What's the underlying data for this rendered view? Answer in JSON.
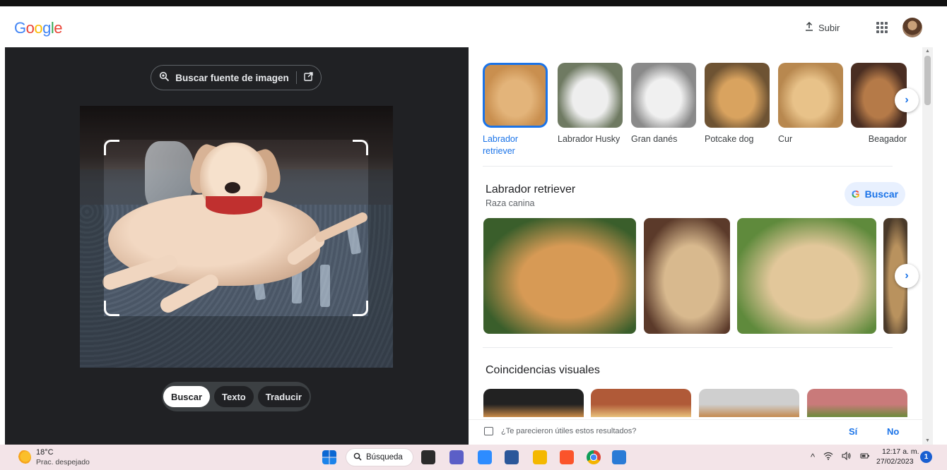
{
  "header": {
    "logo_letters": [
      {
        "char": "G",
        "color": "#4285f4"
      },
      {
        "char": "o",
        "color": "#ea4335"
      },
      {
        "char": "o",
        "color": "#fbbc05"
      },
      {
        "char": "g",
        "color": "#4285f4"
      },
      {
        "char": "l",
        "color": "#34a853"
      },
      {
        "char": "e",
        "color": "#ea4335"
      }
    ],
    "upload_label": "Subir",
    "upload_icon": "upload-icon",
    "apps_icon": "apps-grid-icon"
  },
  "left": {
    "source_button_label": "Buscar fuente de imagen",
    "modes": [
      {
        "label": "Buscar",
        "active": true
      },
      {
        "label": "Texto",
        "active": false
      },
      {
        "label": "Traducir",
        "active": false
      }
    ]
  },
  "right": {
    "thumbnails": [
      {
        "label": "Labrador retriever",
        "selected": true,
        "colors": [
          "#c98f4f",
          "#e3b47a"
        ]
      },
      {
        "label": "Labrador Husky",
        "selected": false,
        "colors": [
          "#6f7a62",
          "#eeeeee"
        ]
      },
      {
        "label": "Gran danés",
        "selected": false,
        "colors": [
          "#8a8a8a",
          "#f0f0f0"
        ]
      },
      {
        "label": "Potcake dog",
        "selected": false,
        "colors": [
          "#6e5333",
          "#d9a35f"
        ]
      },
      {
        "label": "Cur",
        "selected": false,
        "colors": [
          "#b8884f",
          "#e8c289"
        ]
      },
      {
        "label": "Beagador",
        "selected": false,
        "colors": [
          "#4a2e22",
          "#b57a48"
        ]
      }
    ],
    "entity": {
      "title": "Labrador retriever",
      "subtitle": "Raza canina",
      "search_button_label": "Buscar",
      "images": [
        {
          "colors": [
            "#3a5e2b",
            "#d79a55"
          ]
        },
        {
          "colors": [
            "#5b3a2a",
            "#d8b98e"
          ]
        },
        {
          "colors": [
            "#5f8a3c",
            "#e2c79a"
          ]
        },
        {
          "colors": [
            "#4a3a2a",
            "#b9925e"
          ]
        }
      ]
    },
    "visual_matches_title": "Coincidencias visuales",
    "visual_matches": [
      {
        "colors": [
          "#222222",
          "#c98a48"
        ]
      },
      {
        "colors": [
          "#b05a38",
          "#e8c07a"
        ]
      },
      {
        "colors": [
          "#cfcfcf",
          "#c4894e"
        ]
      },
      {
        "colors": [
          "#c97a7a",
          "#6b8a3a"
        ]
      }
    ],
    "feedback": {
      "question": "¿Te parecieron útiles estos resultados?",
      "yes": "Sí",
      "no": "No"
    }
  },
  "taskbar": {
    "weather_temp": "18°C",
    "weather_desc": "Prac. despejado",
    "search_label": "Búsqueda",
    "apps": [
      {
        "name": "start-icon",
        "color": "#0a67d3"
      },
      {
        "name": "file-explorer-dark-icon",
        "color": "#2b2b2b"
      },
      {
        "name": "chat-icon",
        "color": "#5b5fc7"
      },
      {
        "name": "zoom-icon",
        "color": "#2d8cff"
      },
      {
        "name": "word-icon",
        "color": "#2b579a"
      },
      {
        "name": "folder-icon",
        "color": "#f4b800"
      },
      {
        "name": "brave-icon",
        "color": "#fb542b"
      },
      {
        "name": "chrome-icon",
        "color": "#db4437"
      },
      {
        "name": "photos-icon",
        "color": "#2a7bd6"
      }
    ],
    "time": "12:17 a. m.",
    "date": "27/02/2023",
    "notifications": "1"
  }
}
